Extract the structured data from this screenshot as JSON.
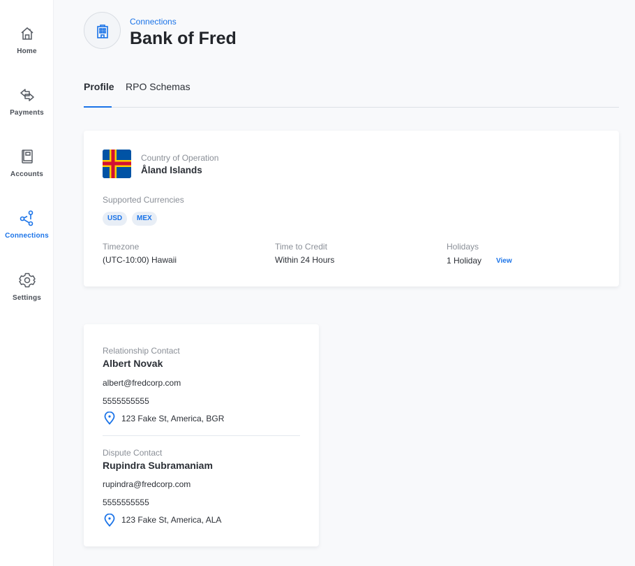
{
  "sidebar": {
    "items": [
      {
        "label": "Home",
        "icon": "home-icon",
        "active": false
      },
      {
        "label": "Payments",
        "icon": "swap-arrows-icon",
        "active": false
      },
      {
        "label": "Accounts",
        "icon": "ledger-book-icon",
        "active": false
      },
      {
        "label": "Connections",
        "icon": "connections-icon",
        "active": true
      },
      {
        "label": "Settings",
        "icon": "gear-icon",
        "active": false
      }
    ]
  },
  "header": {
    "icon": "bank-building-icon",
    "breadcrumb": "Connections",
    "title": "Bank of Fred"
  },
  "tabs": [
    {
      "label": "Profile",
      "active": true
    },
    {
      "label": "RPO Schemas",
      "active": false
    }
  ],
  "profile": {
    "country_label": "Country of Operation",
    "country_value": "Åland Islands",
    "flag_icon": "aland-islands-flag",
    "currencies_label": "Supported Currencies",
    "currencies": [
      "USD",
      "MEX"
    ],
    "timezone_label": "Timezone",
    "timezone_value": "(UTC-10:00) Hawaii",
    "credit_label": "Time to Credit",
    "credit_value": "Within 24 Hours",
    "holidays_label": "Holidays",
    "holidays_value": "1 Holiday",
    "holidays_link": "View"
  },
  "contacts": [
    {
      "role": "Relationship Contact",
      "name": "Albert Novak",
      "email": "albert@fredcorp.com",
      "phone": "5555555555",
      "address": "123 Fake St, America, BGR"
    },
    {
      "role": "Dispute Contact",
      "name": "Rupindra Subramaniam",
      "email": "rupindra@fredcorp.com",
      "phone": "5555555555",
      "address": "123 Fake St, America, ALA"
    }
  ],
  "colors": {
    "accent": "#1a73e8",
    "background": "#f8f9fb",
    "card": "#ffffff"
  }
}
